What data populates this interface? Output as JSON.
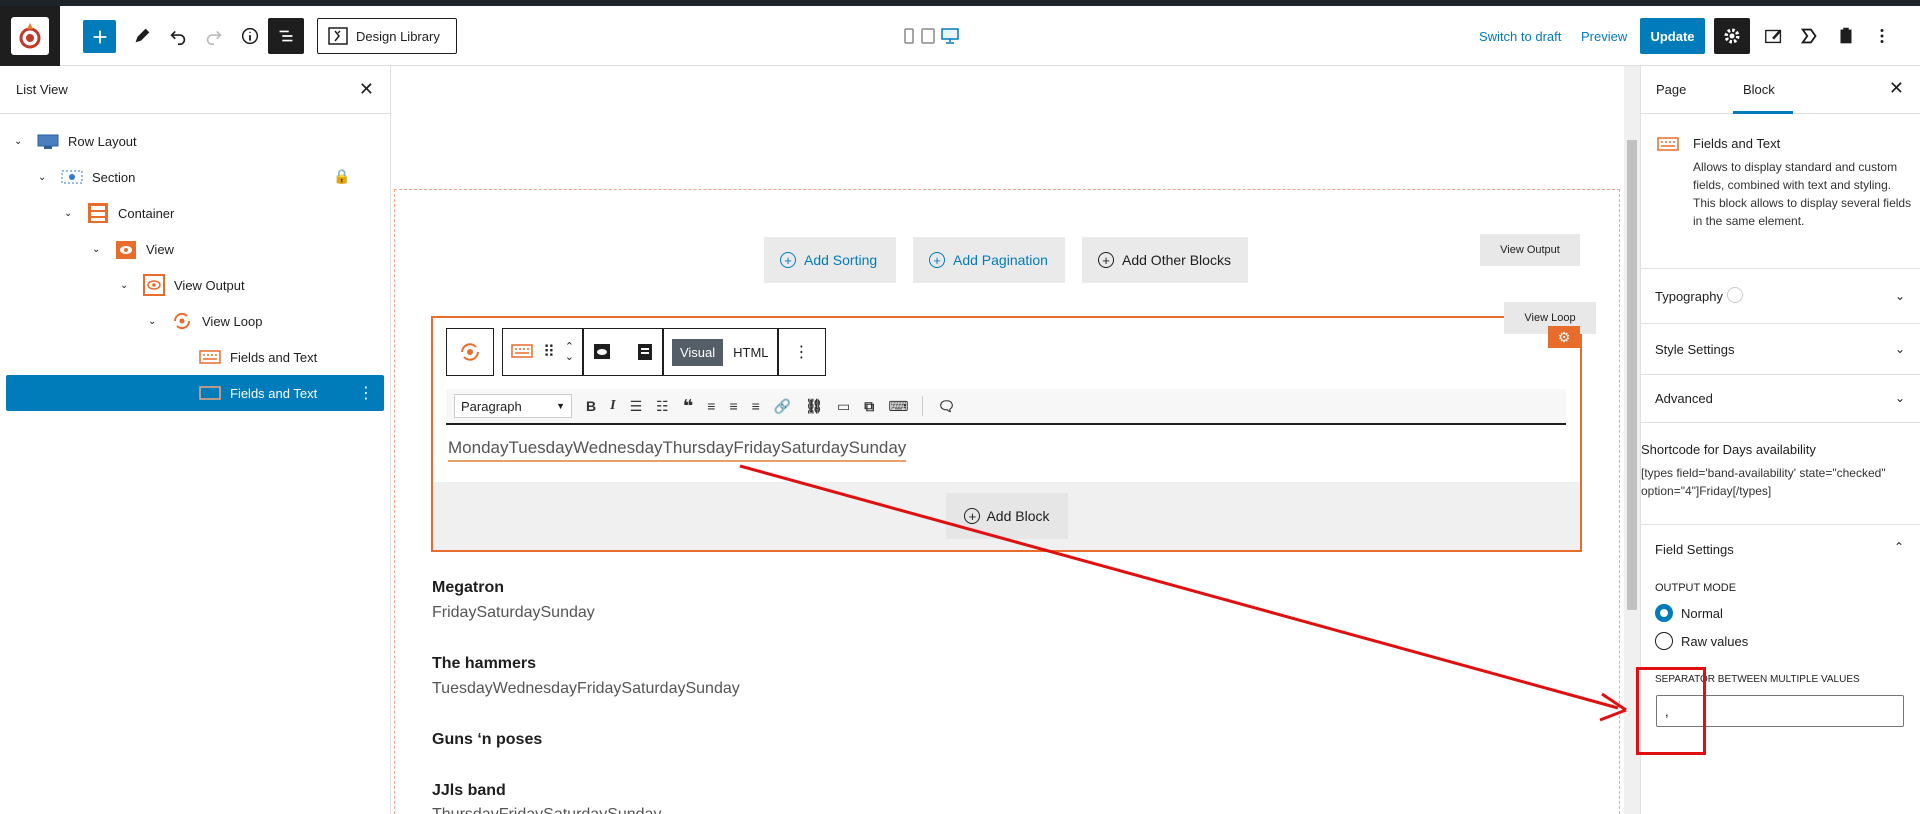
{
  "header": {
    "design_library": "Design Library",
    "switch_to_draft": "Switch to draft",
    "preview": "Preview",
    "update": "Update"
  },
  "list_view": {
    "title": "List View",
    "items": [
      {
        "label": "Row Layout"
      },
      {
        "label": "Section"
      },
      {
        "label": "Container"
      },
      {
        "label": "View"
      },
      {
        "label": "View Output"
      },
      {
        "label": "View Loop"
      },
      {
        "label": "Fields and Text"
      },
      {
        "label": "Fields and Text"
      }
    ]
  },
  "canvas": {
    "add_sorting": "Add Sorting",
    "add_pagination": "Add Pagination",
    "add_other_blocks": "Add Other Blocks",
    "view_output_tag": "View Output",
    "view_loop_tag": "View Loop",
    "toolbar": {
      "visual": "Visual",
      "html": "HTML"
    },
    "editor": {
      "format": "Paragraph"
    },
    "days_text": "MondayTuesdayWednesdayThursdayFridaySaturdaySunday",
    "add_block": "Add Block",
    "bands": [
      {
        "name": "Megatron",
        "days": "FridaySaturdaySunday"
      },
      {
        "name": "The hammers",
        "days": "TuesdayWednesdayFridaySaturdaySunday"
      },
      {
        "name": "Guns ‘n poses",
        "days": ""
      },
      {
        "name": "JJls band",
        "days": "ThursdayFridaySaturdaySunday"
      }
    ]
  },
  "sidebar": {
    "tab_page": "Page",
    "tab_block": "Block",
    "block_title": "Fields and Text",
    "block_desc": "Allows to display standard and custom fields, combined with text and styling. This block allows to display several fields in the same element.",
    "typography": "Typography",
    "style_settings": "Style Settings",
    "advanced": "Advanced",
    "shortcode_title": "Shortcode for Days availability",
    "shortcode_text": "[types field='band-availability' state=\"checked\" option=\"4\"]Friday[/types]",
    "field_settings": "Field Settings",
    "output_mode_label": "OUTPUT MODE",
    "mode_normal": "Normal",
    "mode_raw": "Raw values",
    "separator_label": "SEPARATOR BETWEEN MULTIPLE VALUES",
    "separator_value": ","
  },
  "colors": {
    "accent": "#007cba",
    "orange": "#e86c2c",
    "annotation": "#e01010"
  }
}
